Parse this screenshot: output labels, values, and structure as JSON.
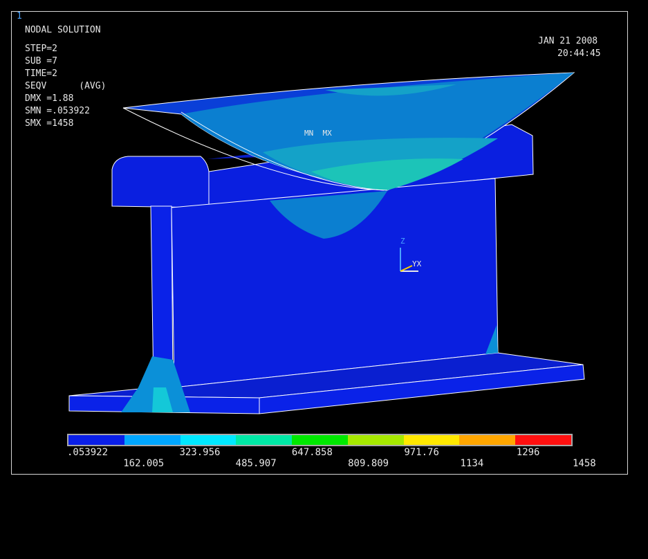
{
  "window_number": "1",
  "header": {
    "title": "NODAL SOLUTION",
    "step": "STEP=2",
    "sub": "SUB =7",
    "time": "TIME=2",
    "result": "SEQV      (AVG)",
    "dmx": "DMX =1.88",
    "smn": "SMN =.053922",
    "smx": "SMX =1458"
  },
  "date": "JAN 21 2008",
  "clock": "20:44:45",
  "markers": {
    "mnmx": "MN  MX"
  },
  "triad": {
    "z": "Z",
    "yx": "YX"
  },
  "legend": {
    "colors": [
      "#0a1fe8",
      "#00a6ff",
      "#00e8ff",
      "#00e8a6",
      "#00e800",
      "#a6e800",
      "#ffe800",
      "#ffa600",
      "#ff1010"
    ],
    "labels_top": [
      ".053922",
      "323.956",
      "647.858",
      "971.76",
      "1296"
    ],
    "labels_bottom": [
      "162.005",
      "485.907",
      "809.809",
      "1134",
      "1458"
    ]
  },
  "colors": {
    "base": "#0a1fe0",
    "band2": "#0b7fd0",
    "band3": "#14a2c8",
    "band4": "#1cc4b8",
    "edge": "#ffffff",
    "frame": "#d8d8d8"
  }
}
